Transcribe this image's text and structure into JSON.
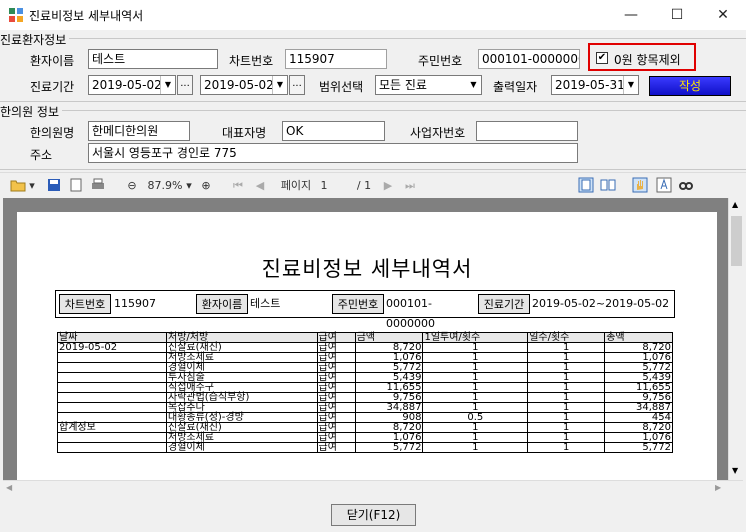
{
  "window": {
    "title": "진료비정보 세부내역서",
    "minimize": "—",
    "maximize": "☐",
    "close": "✕"
  },
  "patient_group": {
    "label": "진료환자정보",
    "name_label": "환자이름",
    "name_value": "테스트",
    "chart_label": "차트번호",
    "chart_value": "115907",
    "id_label": "주민번호",
    "id_value": "000101-0000000",
    "exclude_zero_label": "0원 항목제외",
    "exclude_zero_checked": "✔",
    "period_label": "진료기간",
    "period_from": "2019-05-02",
    "period_to": "2019-05-02",
    "ellipsis": "...",
    "range_label": "범위선택",
    "range_value": "모든 진료",
    "print_date_label": "출력일자",
    "print_date_value": "2019-05-31",
    "create_button": "작성"
  },
  "clinic_group": {
    "label": "한의원 정보",
    "clinic_name_label": "한의원명",
    "clinic_name_value": "한메디한의원",
    "rep_label": "대표자명",
    "rep_value": "OK",
    "biz_label": "사업자번호",
    "biz_value": "",
    "addr_label": "주소",
    "addr_value": "서울시 영등포구 경인로 775"
  },
  "toolbar": {
    "zoom": "87.9%",
    "page_label": "페이지",
    "page_current": "1",
    "page_total": "/ 1"
  },
  "document": {
    "title": "진료비정보 세부내역서",
    "info": {
      "chart_h": "차트번호",
      "chart_v": "115907",
      "name_h": "환자이름",
      "name_v": "테스트",
      "id_h": "주민번호",
      "id_v": "000101-0000000",
      "period_h": "진료기간",
      "period_v": "2019-05-02~2019-05-02"
    },
    "columns": [
      "날짜",
      "처방/처방",
      "급여",
      "금액",
      "1일투여/횟수",
      "일수/횟수",
      "총액"
    ],
    "rows": [
      [
        "2019-05-02",
        "진찰료(재진)",
        "급여",
        "8,720",
        "1",
        "1",
        "8,720"
      ],
      [
        "",
        "처방조제료",
        "급여",
        "1,076",
        "1",
        "1",
        "1,076"
      ],
      [
        "",
        "경혈이체",
        "급여",
        "5,772",
        "1",
        "1",
        "5,772"
      ],
      [
        "",
        "투자침술",
        "급여",
        "5,439",
        "1",
        "1",
        "5,439"
      ],
      [
        "",
        "직접애주구",
        "급여",
        "11,655",
        "1",
        "1",
        "11,655"
      ],
      [
        "",
        "자락관법(습식부항)",
        "급여",
        "9,756",
        "1",
        "1",
        "9,756"
      ],
      [
        "",
        "복잡추나",
        "급여",
        "34,887",
        "1",
        "1",
        "34,887"
      ],
      [
        "",
        "대황종류(정)-경방",
        "급여",
        "908",
        "0.5",
        "1",
        "454"
      ],
      [
        "합계정보",
        "진찰료(재진)",
        "급여",
        "8,720",
        "1",
        "1",
        "8,720"
      ],
      [
        "",
        "처방조제료",
        "급여",
        "1,076",
        "1",
        "1",
        "1,076"
      ],
      [
        "",
        "경혈이체",
        "급여",
        "5,772",
        "1",
        "1",
        "5,772"
      ]
    ]
  },
  "close_button": "닫기(F12)"
}
